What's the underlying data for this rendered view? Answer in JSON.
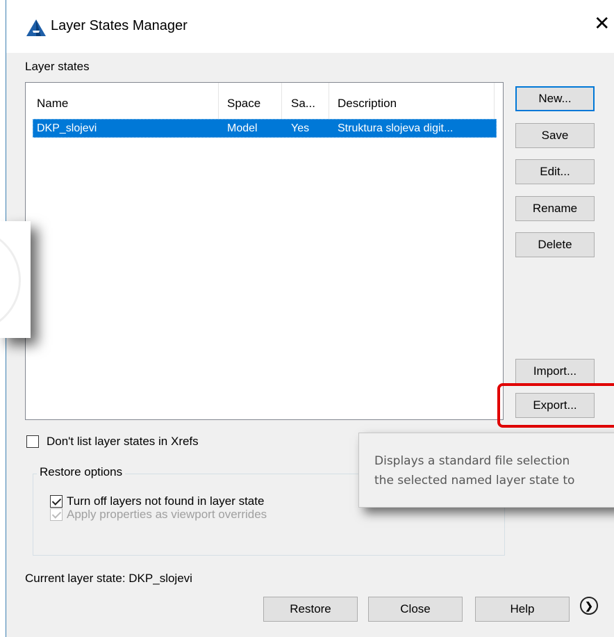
{
  "window": {
    "title": "Layer States Manager",
    "close_glyph": "✕"
  },
  "list_label": "Layer states",
  "columns": {
    "name": "Name",
    "space": "Space",
    "saved": "Sa...",
    "description": "Description"
  },
  "rows": [
    {
      "name": "DKP_slojevi",
      "space": "Model",
      "saved": "Yes",
      "description": "Struktura slojeva digit..."
    }
  ],
  "buttons": {
    "new": "New...",
    "save": "Save",
    "edit": "Edit...",
    "rename": "Rename",
    "delete": "Delete",
    "import": "Import...",
    "export": "Export..."
  },
  "checkboxes": {
    "dont_list_xrefs": {
      "label": "Don't list layer states in Xrefs",
      "checked": false
    }
  },
  "restore_options": {
    "title": "Restore options",
    "turn_off": {
      "label": "Turn off layers not found in layer state",
      "checked": true
    },
    "apply_props": {
      "label": "Apply properties as viewport overrides",
      "checked": true,
      "disabled": true
    }
  },
  "current_state": "Current layer state: DKP_slojevi",
  "footer_buttons": {
    "restore": "Restore",
    "close": "Close",
    "help": "Help"
  },
  "tooltip": {
    "line1": "Displays a standard file selection",
    "line2": "the selected named layer state to"
  },
  "colors": {
    "selection": "#0078d7",
    "highlight": "#e00000",
    "accent": "#0078d7"
  }
}
